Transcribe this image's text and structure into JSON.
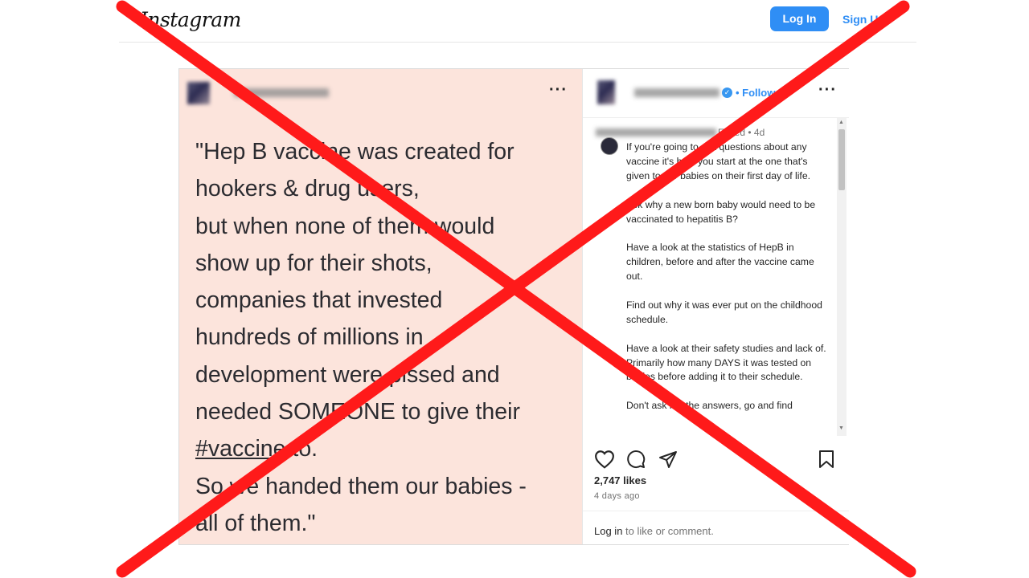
{
  "header": {
    "logo_text": "Instagram",
    "login_button": "Log In",
    "signup_link": "Sign Up"
  },
  "post": {
    "options_icon": "more-horizontal-icon",
    "quote_lines": [
      "\"Hep B vaccine was created for",
      "hookers & drug users,",
      "but when none of them would",
      "show up for their shots,",
      "companies that invested",
      "hundreds of millions in",
      "development were pissed and",
      "needed SOMEONE to give their",
      "#vaccine",
      " to.",
      "So we handed them our babies -",
      "all of them.\""
    ]
  },
  "sidebar": {
    "follow_label": "Follow",
    "options_icon": "more-horizontal-icon",
    "comment": {
      "meta": "Edited • 4d",
      "paragraphs": [
        "If you're going to ask questions about any vaccine it's best you start at the one that's given to our babies on their first day of life.",
        "Ask why a new born baby would need to be vaccinated to hepatitis B?",
        "Have a look at the statistics of HepB in children, before and after the vaccine came out.",
        "Find out why it was ever put on the childhood schedule.",
        "Have a look at their safety studies and lack of. Primarily how many DAYS it was tested on babies before adding it to their schedule.",
        "Don't ask me the answers, go and find"
      ]
    },
    "likes": "2,747 likes",
    "date": "4 days ago",
    "login_prompt": {
      "link": "Log in",
      "rest": " to like or comment."
    }
  },
  "overlay": {
    "cross_color": "#ff1a1a"
  }
}
